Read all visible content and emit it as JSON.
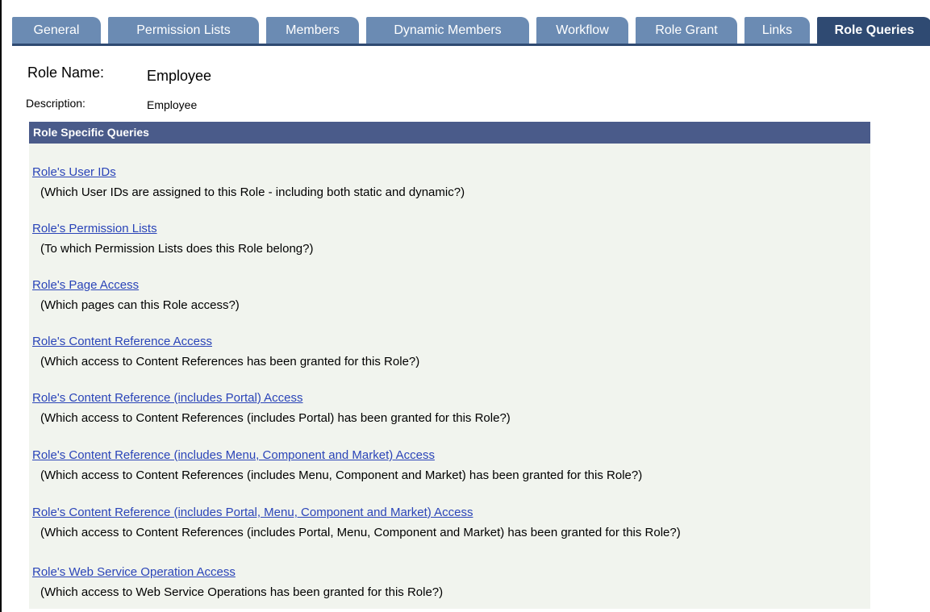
{
  "tabs": [
    {
      "label": "General"
    },
    {
      "label": "Permission Lists"
    },
    {
      "label": "Members"
    },
    {
      "label": "Dynamic Members"
    },
    {
      "label": "Workflow"
    },
    {
      "label": "Role Grant"
    },
    {
      "label": "Links"
    },
    {
      "label": "Role Queries",
      "active": true
    }
  ],
  "role": {
    "name_label": "Role Name:",
    "name_value": "Employee",
    "description_label": "Description:",
    "description_value": "Employee"
  },
  "section": {
    "title": "Role Specific Queries",
    "queries": [
      {
        "link": "Role's User IDs",
        "desc": "(Which User IDs are assigned to this Role - including both static and dynamic?)"
      },
      {
        "link": "Role's Permission Lists",
        "desc": "(To which Permission Lists does this Role belong?)"
      },
      {
        "link": "Role's Page Access",
        "desc": "(Which pages can this Role access?)"
      },
      {
        "link": "Role's Content Reference Access",
        "desc": "(Which access to Content References has been granted for this Role?)"
      },
      {
        "link": "Role's Content Reference (includes Portal) Access",
        "desc": "(Which access to Content References (includes Portal) has been granted for this Role?)"
      },
      {
        "link": "Role's Content Reference (includes Menu, Component and Market) Access",
        "desc": "(Which access to Content References (includes Menu, Component and Market) has been granted for this Role?)"
      },
      {
        "link": "Role's Content Reference (includes Portal, Menu, Component and Market) Access",
        "desc": "(Which access to Content References (includes Portal, Menu, Component and Market) has been granted for this Role?)"
      },
      {
        "link": "Role's Web Service Operation Access",
        "desc": "(Which access to Web Service Operations has been granted for this Role?)"
      }
    ]
  }
}
